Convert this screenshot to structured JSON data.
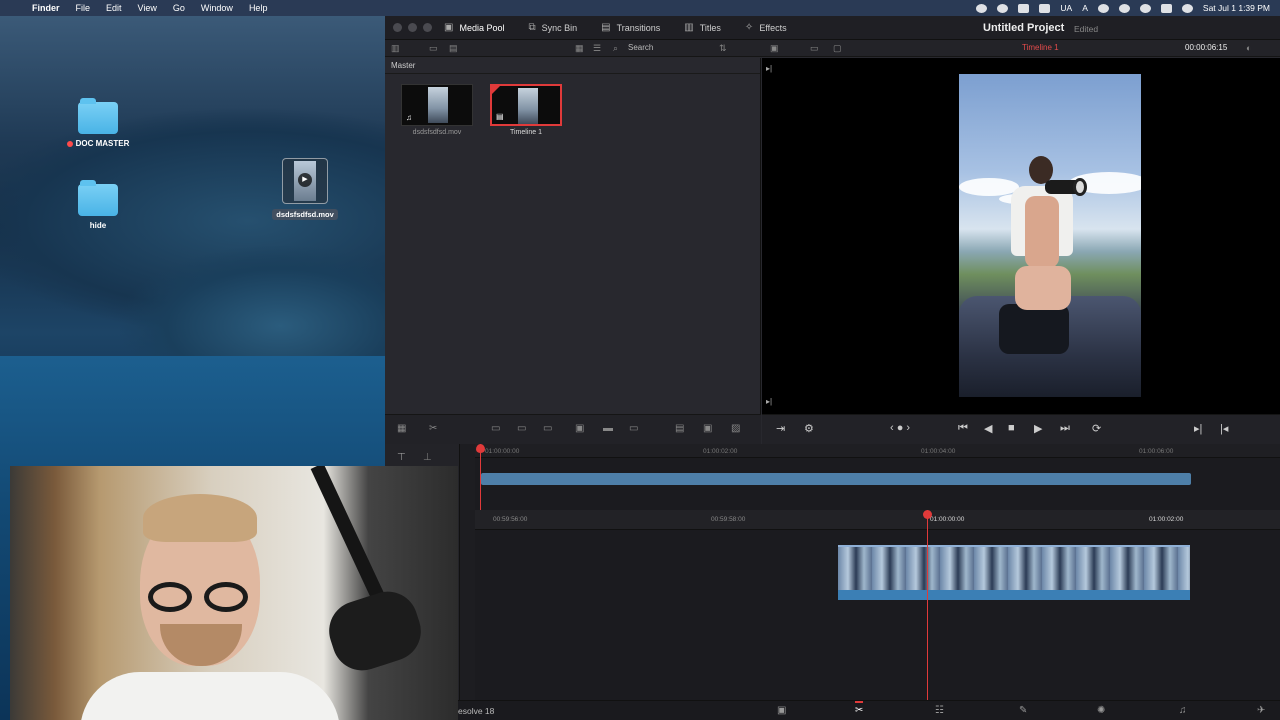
{
  "menubar": {
    "items": [
      "Finder",
      "File",
      "Edit",
      "View",
      "Go",
      "Window",
      "Help"
    ],
    "input_source": "UA",
    "input_letter": "A",
    "clock": "Sat Jul 1  1:39 PM"
  },
  "desktop": {
    "icons": [
      {
        "label": "DOC MASTER",
        "tagged": true
      },
      {
        "label": "hide",
        "tagged": false
      }
    ],
    "dragged_file": "dsdsfsdfsd.mov"
  },
  "resolve": {
    "tabs": [
      {
        "label": "Media Pool",
        "active": true
      },
      {
        "label": "Sync Bin",
        "active": false
      },
      {
        "label": "Transitions",
        "active": false
      },
      {
        "label": "Titles",
        "active": false
      },
      {
        "label": "Effects",
        "active": false
      }
    ],
    "project_title": "Untitled Project",
    "project_state": "Edited",
    "search_label": "Search",
    "timeline_name": "Timeline 1",
    "viewer_timecode": "00:00:06:15",
    "bin_name": "Master",
    "clips": [
      {
        "name": "dsdsfsdfsd.mov",
        "selected": false
      },
      {
        "name": "Timeline 1",
        "selected": true
      }
    ],
    "mini_ruler": [
      "01:00:00:00",
      "01:00:02:00",
      "01:00:04:00",
      "01:00:06:00"
    ],
    "main_ruler": [
      "00:59:56:00",
      "00:59:58:00",
      "01:00:00:00",
      "01:00:02:00"
    ],
    "app_name": "esolve 18",
    "accent": "#e03a3a"
  }
}
